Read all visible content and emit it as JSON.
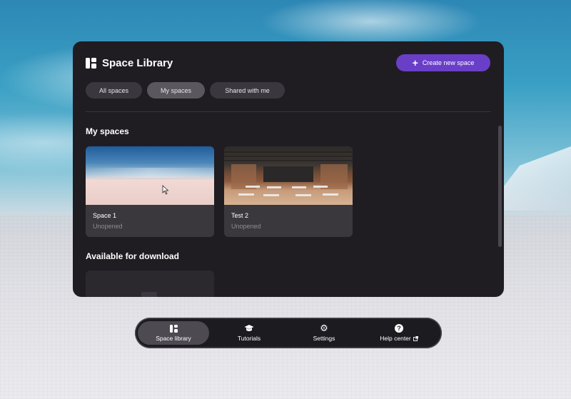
{
  "library": {
    "title": "Space Library",
    "create_button": "Create new space",
    "tabs": [
      {
        "label": "All spaces",
        "active": false
      },
      {
        "label": "My spaces",
        "active": true
      },
      {
        "label": "Shared with me",
        "active": false
      }
    ],
    "my_spaces_heading": "My spaces",
    "spaces": [
      {
        "name": "Space 1",
        "status": "Unopened",
        "thumbnail": "sky-landscape"
      },
      {
        "name": "Test 2",
        "status": "Unopened",
        "thumbnail": "classroom-interior"
      }
    ],
    "available_heading": "Available for download"
  },
  "dock": {
    "items": [
      {
        "label": "Space library",
        "icon": "library-icon",
        "active": true
      },
      {
        "label": "Tutorials",
        "icon": "graduation-cap-icon",
        "active": false
      },
      {
        "label": "Settings",
        "icon": "gear-icon",
        "active": false
      },
      {
        "label": "Help center",
        "icon": "help-icon",
        "active": false,
        "external": true
      }
    ]
  },
  "colors": {
    "accent": "#6a3fc8",
    "panel_bg": "#1f1d22",
    "card_bg": "#3a383d"
  }
}
